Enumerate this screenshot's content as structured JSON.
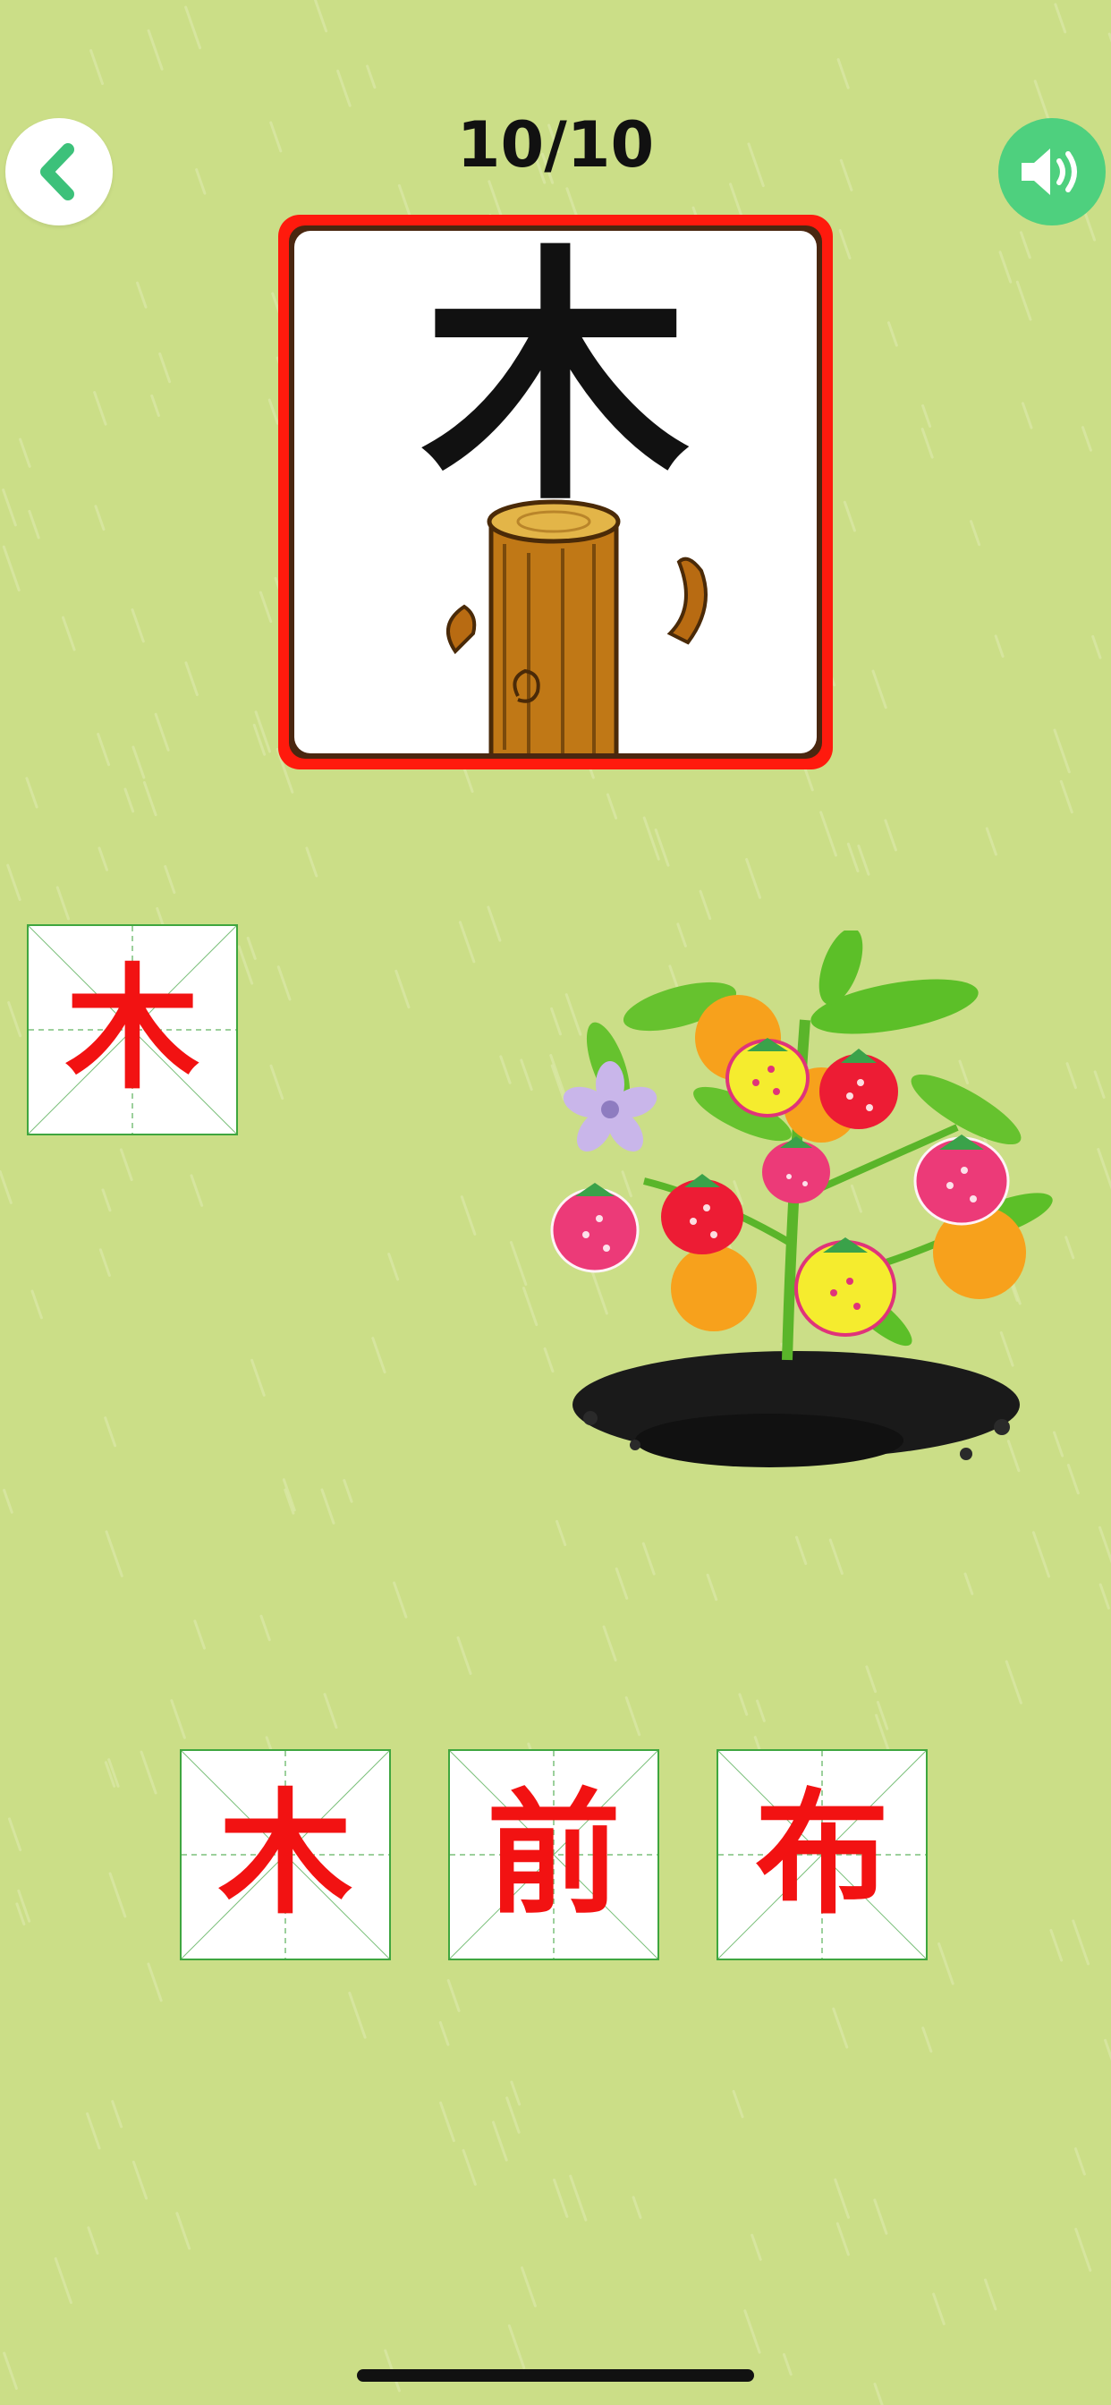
{
  "header": {
    "progress": "10/10",
    "back_icon": "chevron-left-icon",
    "sound_icon": "speaker-icon"
  },
  "card": {
    "character": "木",
    "illustration": "tree-stump"
  },
  "answer_slot": {
    "character": "木"
  },
  "options": [
    {
      "character": "木"
    },
    {
      "character": "前"
    },
    {
      "character": "布"
    }
  ],
  "colors": {
    "background": "#cbde87",
    "accent_green": "#4ed07e",
    "character_red": "#f21212",
    "card_border": "#ff1a0d"
  }
}
